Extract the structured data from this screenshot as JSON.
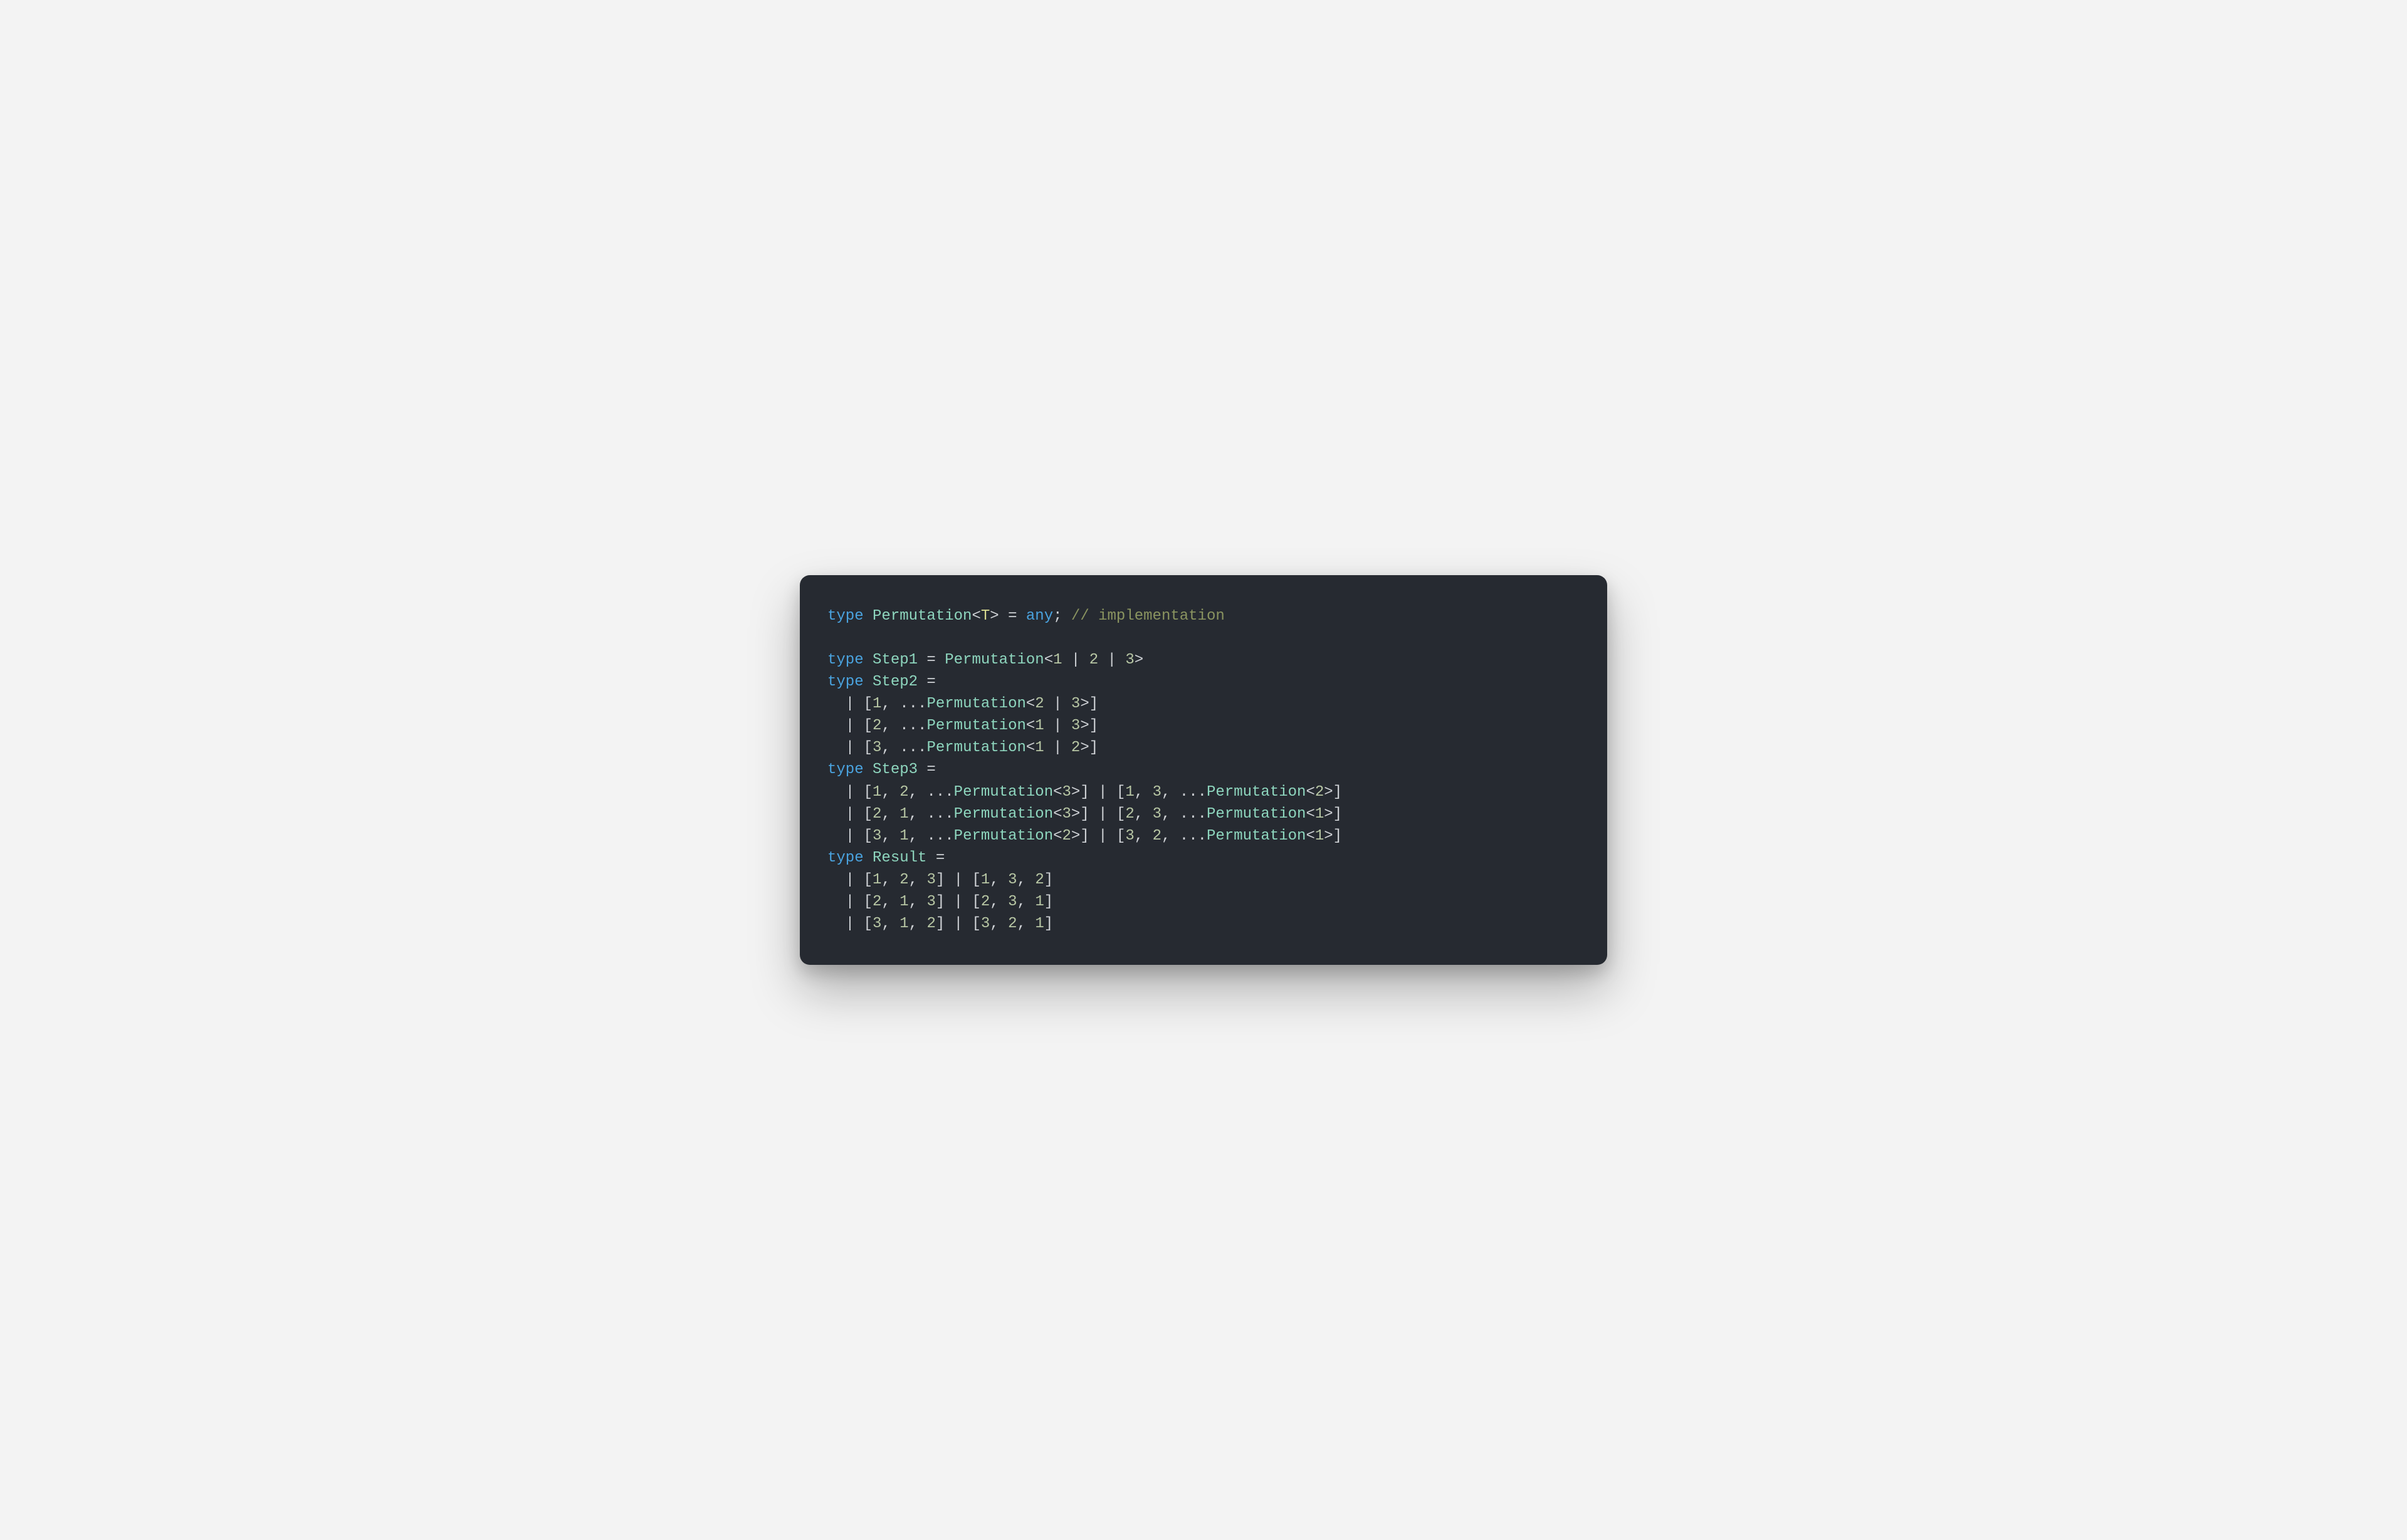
{
  "code": {
    "lines": [
      [
        {
          "t": "type ",
          "c": "kw"
        },
        {
          "t": "Permutation",
          "c": "typ"
        },
        {
          "t": "<",
          "c": "op"
        },
        {
          "t": "T",
          "c": "tpar"
        },
        {
          "t": ">",
          "c": "op"
        },
        {
          "t": " = ",
          "c": "op"
        },
        {
          "t": "any",
          "c": "anyk"
        },
        {
          "t": "; ",
          "c": "op"
        },
        {
          "t": "// implementation",
          "c": "cmt"
        }
      ],
      [],
      [
        {
          "t": "type ",
          "c": "kw"
        },
        {
          "t": "Step1",
          "c": "typ"
        },
        {
          "t": " = ",
          "c": "op"
        },
        {
          "t": "Permutation",
          "c": "typ"
        },
        {
          "t": "<",
          "c": "op"
        },
        {
          "t": "1",
          "c": "num"
        },
        {
          "t": " | ",
          "c": "op"
        },
        {
          "t": "2",
          "c": "num"
        },
        {
          "t": " | ",
          "c": "op"
        },
        {
          "t": "3",
          "c": "num"
        },
        {
          "t": ">",
          "c": "op"
        }
      ],
      [
        {
          "t": "type ",
          "c": "kw"
        },
        {
          "t": "Step2",
          "c": "typ"
        },
        {
          "t": " =",
          "c": "op"
        }
      ],
      [
        {
          "t": "  | ",
          "c": "op"
        },
        {
          "t": "[",
          "c": "brk"
        },
        {
          "t": "1",
          "c": "num"
        },
        {
          "t": ", ",
          "c": "op"
        },
        {
          "t": "...",
          "c": "op"
        },
        {
          "t": "Permutation",
          "c": "typ"
        },
        {
          "t": "<",
          "c": "op"
        },
        {
          "t": "2",
          "c": "num"
        },
        {
          "t": " | ",
          "c": "op"
        },
        {
          "t": "3",
          "c": "num"
        },
        {
          "t": ">",
          "c": "op"
        },
        {
          "t": "]",
          "c": "brk"
        }
      ],
      [
        {
          "t": "  | ",
          "c": "op"
        },
        {
          "t": "[",
          "c": "brk"
        },
        {
          "t": "2",
          "c": "num"
        },
        {
          "t": ", ",
          "c": "op"
        },
        {
          "t": "...",
          "c": "op"
        },
        {
          "t": "Permutation",
          "c": "typ"
        },
        {
          "t": "<",
          "c": "op"
        },
        {
          "t": "1",
          "c": "num"
        },
        {
          "t": " | ",
          "c": "op"
        },
        {
          "t": "3",
          "c": "num"
        },
        {
          "t": ">",
          "c": "op"
        },
        {
          "t": "]",
          "c": "brk"
        }
      ],
      [
        {
          "t": "  | ",
          "c": "op"
        },
        {
          "t": "[",
          "c": "brk"
        },
        {
          "t": "3",
          "c": "num"
        },
        {
          "t": ", ",
          "c": "op"
        },
        {
          "t": "...",
          "c": "op"
        },
        {
          "t": "Permutation",
          "c": "typ"
        },
        {
          "t": "<",
          "c": "op"
        },
        {
          "t": "1",
          "c": "num"
        },
        {
          "t": " | ",
          "c": "op"
        },
        {
          "t": "2",
          "c": "num"
        },
        {
          "t": ">",
          "c": "op"
        },
        {
          "t": "]",
          "c": "brk"
        }
      ],
      [
        {
          "t": "type ",
          "c": "kw"
        },
        {
          "t": "Step3",
          "c": "typ"
        },
        {
          "t": " =",
          "c": "op"
        }
      ],
      [
        {
          "t": "  | ",
          "c": "op"
        },
        {
          "t": "[",
          "c": "brk"
        },
        {
          "t": "1",
          "c": "num"
        },
        {
          "t": ", ",
          "c": "op"
        },
        {
          "t": "2",
          "c": "num"
        },
        {
          "t": ", ",
          "c": "op"
        },
        {
          "t": "...",
          "c": "op"
        },
        {
          "t": "Permutation",
          "c": "typ"
        },
        {
          "t": "<",
          "c": "op"
        },
        {
          "t": "3",
          "c": "num"
        },
        {
          "t": ">",
          "c": "op"
        },
        {
          "t": "]",
          "c": "brk"
        },
        {
          "t": " | ",
          "c": "op"
        },
        {
          "t": "[",
          "c": "brk"
        },
        {
          "t": "1",
          "c": "num"
        },
        {
          "t": ", ",
          "c": "op"
        },
        {
          "t": "3",
          "c": "num"
        },
        {
          "t": ", ",
          "c": "op"
        },
        {
          "t": "...",
          "c": "op"
        },
        {
          "t": "Permutation",
          "c": "typ"
        },
        {
          "t": "<",
          "c": "op"
        },
        {
          "t": "2",
          "c": "num"
        },
        {
          "t": ">",
          "c": "op"
        },
        {
          "t": "]",
          "c": "brk"
        }
      ],
      [
        {
          "t": "  | ",
          "c": "op"
        },
        {
          "t": "[",
          "c": "brk"
        },
        {
          "t": "2",
          "c": "num"
        },
        {
          "t": ", ",
          "c": "op"
        },
        {
          "t": "1",
          "c": "num"
        },
        {
          "t": ", ",
          "c": "op"
        },
        {
          "t": "...",
          "c": "op"
        },
        {
          "t": "Permutation",
          "c": "typ"
        },
        {
          "t": "<",
          "c": "op"
        },
        {
          "t": "3",
          "c": "num"
        },
        {
          "t": ">",
          "c": "op"
        },
        {
          "t": "]",
          "c": "brk"
        },
        {
          "t": " | ",
          "c": "op"
        },
        {
          "t": "[",
          "c": "brk"
        },
        {
          "t": "2",
          "c": "num"
        },
        {
          "t": ", ",
          "c": "op"
        },
        {
          "t": "3",
          "c": "num"
        },
        {
          "t": ", ",
          "c": "op"
        },
        {
          "t": "...",
          "c": "op"
        },
        {
          "t": "Permutation",
          "c": "typ"
        },
        {
          "t": "<",
          "c": "op"
        },
        {
          "t": "1",
          "c": "num"
        },
        {
          "t": ">",
          "c": "op"
        },
        {
          "t": "]",
          "c": "brk"
        }
      ],
      [
        {
          "t": "  | ",
          "c": "op"
        },
        {
          "t": "[",
          "c": "brk"
        },
        {
          "t": "3",
          "c": "num"
        },
        {
          "t": ", ",
          "c": "op"
        },
        {
          "t": "1",
          "c": "num"
        },
        {
          "t": ", ",
          "c": "op"
        },
        {
          "t": "...",
          "c": "op"
        },
        {
          "t": "Permutation",
          "c": "typ"
        },
        {
          "t": "<",
          "c": "op"
        },
        {
          "t": "2",
          "c": "num"
        },
        {
          "t": ">",
          "c": "op"
        },
        {
          "t": "]",
          "c": "brk"
        },
        {
          "t": " | ",
          "c": "op"
        },
        {
          "t": "[",
          "c": "brk"
        },
        {
          "t": "3",
          "c": "num"
        },
        {
          "t": ", ",
          "c": "op"
        },
        {
          "t": "2",
          "c": "num"
        },
        {
          "t": ", ",
          "c": "op"
        },
        {
          "t": "...",
          "c": "op"
        },
        {
          "t": "Permutation",
          "c": "typ"
        },
        {
          "t": "<",
          "c": "op"
        },
        {
          "t": "1",
          "c": "num"
        },
        {
          "t": ">",
          "c": "op"
        },
        {
          "t": "]",
          "c": "brk"
        }
      ],
      [
        {
          "t": "type ",
          "c": "kw"
        },
        {
          "t": "Result",
          "c": "typ"
        },
        {
          "t": " =",
          "c": "op"
        }
      ],
      [
        {
          "t": "  | ",
          "c": "op"
        },
        {
          "t": "[",
          "c": "brk"
        },
        {
          "t": "1",
          "c": "num"
        },
        {
          "t": ", ",
          "c": "op"
        },
        {
          "t": "2",
          "c": "num"
        },
        {
          "t": ", ",
          "c": "op"
        },
        {
          "t": "3",
          "c": "num"
        },
        {
          "t": "]",
          "c": "brk"
        },
        {
          "t": " | ",
          "c": "op"
        },
        {
          "t": "[",
          "c": "brk"
        },
        {
          "t": "1",
          "c": "num"
        },
        {
          "t": ", ",
          "c": "op"
        },
        {
          "t": "3",
          "c": "num"
        },
        {
          "t": ", ",
          "c": "op"
        },
        {
          "t": "2",
          "c": "num"
        },
        {
          "t": "]",
          "c": "brk"
        }
      ],
      [
        {
          "t": "  | ",
          "c": "op"
        },
        {
          "t": "[",
          "c": "brk"
        },
        {
          "t": "2",
          "c": "num"
        },
        {
          "t": ", ",
          "c": "op"
        },
        {
          "t": "1",
          "c": "num"
        },
        {
          "t": ", ",
          "c": "op"
        },
        {
          "t": "3",
          "c": "num"
        },
        {
          "t": "]",
          "c": "brk"
        },
        {
          "t": " | ",
          "c": "op"
        },
        {
          "t": "[",
          "c": "brk"
        },
        {
          "t": "2",
          "c": "num"
        },
        {
          "t": ", ",
          "c": "op"
        },
        {
          "t": "3",
          "c": "num"
        },
        {
          "t": ", ",
          "c": "op"
        },
        {
          "t": "1",
          "c": "num"
        },
        {
          "t": "]",
          "c": "brk"
        }
      ],
      [
        {
          "t": "  | ",
          "c": "op"
        },
        {
          "t": "[",
          "c": "brk"
        },
        {
          "t": "3",
          "c": "num"
        },
        {
          "t": ", ",
          "c": "op"
        },
        {
          "t": "1",
          "c": "num"
        },
        {
          "t": ", ",
          "c": "op"
        },
        {
          "t": "2",
          "c": "num"
        },
        {
          "t": "]",
          "c": "brk"
        },
        {
          "t": " | ",
          "c": "op"
        },
        {
          "t": "[",
          "c": "brk"
        },
        {
          "t": "3",
          "c": "num"
        },
        {
          "t": ", ",
          "c": "op"
        },
        {
          "t": "2",
          "c": "num"
        },
        {
          "t": ", ",
          "c": "op"
        },
        {
          "t": "1",
          "c": "num"
        },
        {
          "t": "]",
          "c": "brk"
        }
      ]
    ]
  }
}
